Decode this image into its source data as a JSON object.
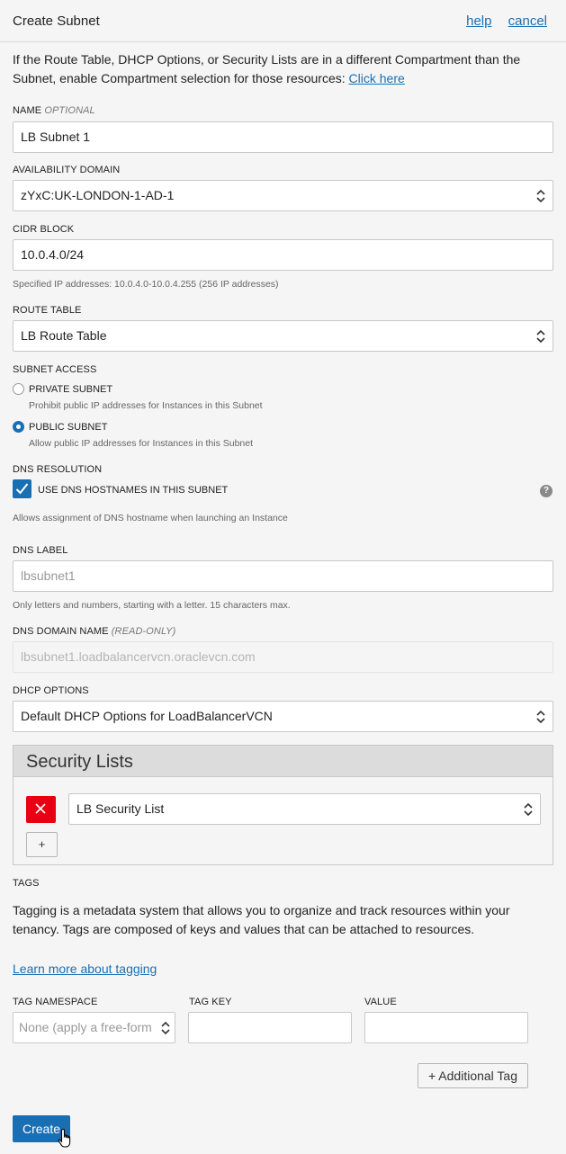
{
  "header": {
    "title": "Create Subnet",
    "help_link": "help",
    "cancel_link": "cancel"
  },
  "intro": {
    "text": "If the Route Table, DHCP Options, or Security Lists are in a different Compartment than the Subnet, enable Compartment selection for those resources:",
    "link": "Click here"
  },
  "name": {
    "label": "NAME",
    "optional": "OPTIONAL",
    "value": "LB Subnet 1"
  },
  "availability_domain": {
    "label": "AVAILABILITY DOMAIN",
    "value": "zYxC:UK-LONDON-1-AD-1"
  },
  "cidr": {
    "label": "CIDR BLOCK",
    "value": "10.0.4.0/24",
    "help": "Specified IP addresses: 10.0.4.0-10.0.4.255 (256 IP addresses)"
  },
  "route_table": {
    "label": "ROUTE TABLE",
    "value": "LB Route Table"
  },
  "subnet_access": {
    "label": "SUBNET ACCESS",
    "private": {
      "label": "PRIVATE SUBNET",
      "help": "Prohibit public IP addresses for Instances in this Subnet",
      "checked": false
    },
    "public": {
      "label": "PUBLIC SUBNET",
      "help": "Allow public IP addresses for Instances in this Subnet",
      "checked": true
    }
  },
  "dns_resolution": {
    "label": "DNS RESOLUTION",
    "checkbox_label": "USE DNS HOSTNAMES IN THIS SUBNET",
    "checked": true,
    "help": "Allows assignment of DNS hostname when launching an Instance"
  },
  "dns_label": {
    "label": "DNS LABEL",
    "value": "lbsubnet1",
    "help": "Only letters and numbers, starting with a letter. 15 characters max."
  },
  "dns_domain": {
    "label": "DNS DOMAIN NAME",
    "readonly": "(READ-ONLY)",
    "value": "lbsubnet1.loadbalancervcn.oraclevcn.com"
  },
  "dhcp": {
    "label": "DHCP OPTIONS",
    "value": "Default DHCP Options for LoadBalancerVCN"
  },
  "security_lists": {
    "title": "Security Lists",
    "items": [
      {
        "value": "LB Security List"
      }
    ],
    "add_label": "+"
  },
  "tags": {
    "label": "TAGS",
    "description": "Tagging is a metadata system that allows you to organize and track resources within your tenancy. Tags are composed of keys and values that can be attached to resources.",
    "learn_more": "Learn more about tagging",
    "namespace_label": "TAG NAMESPACE",
    "namespace_value": "None (apply a free-form",
    "key_label": "TAG KEY",
    "value_label": "VALUE",
    "additional_tag": "+ Additional Tag"
  },
  "create_button": "Create",
  "colors": {
    "accent": "#1a6fb3",
    "danger": "#e60012"
  }
}
